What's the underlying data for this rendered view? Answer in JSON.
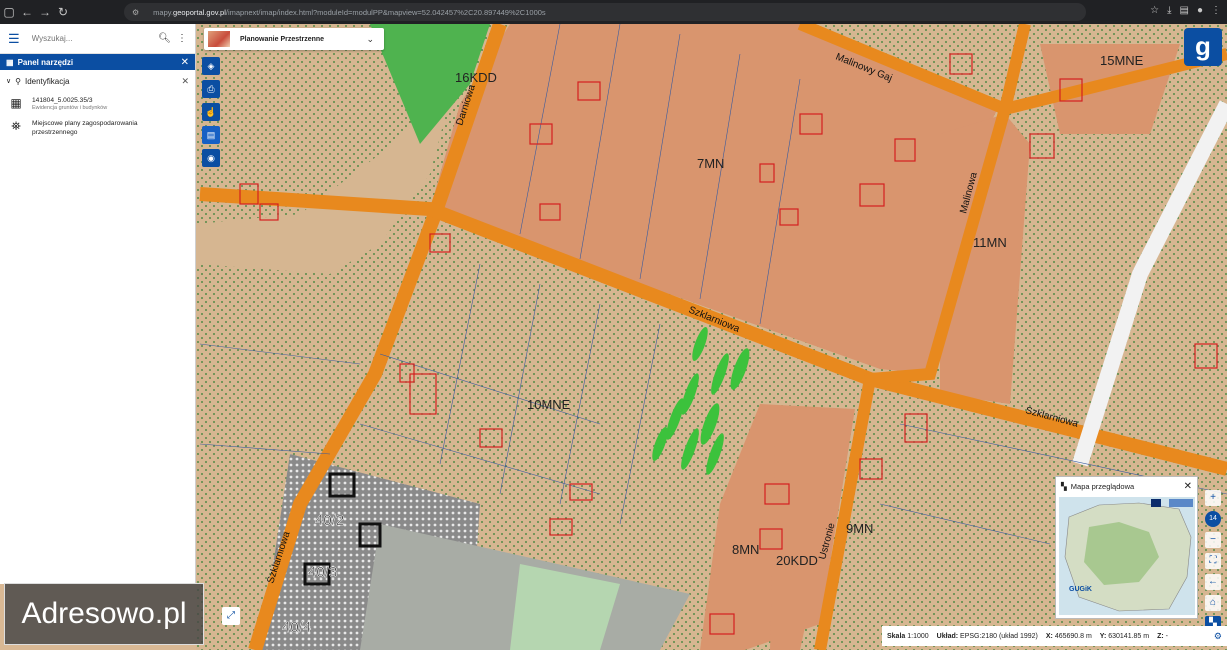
{
  "browser": {
    "url_prefix": "mapy.",
    "url_domain": "geoportal.gov.pl",
    "url_rest": "/imapnext/imap/index.html?moduleId=modulPP&mapview=52.042457%2C20.897449%2C1000s",
    "icons": [
      "back-arrow",
      "forward-arrow",
      "reload",
      "bookmark-star",
      "download",
      "extensions",
      "profile"
    ]
  },
  "search": {
    "placeholder": "Wyszukaj..."
  },
  "panel": {
    "title": "Panel narzędzi",
    "section": "Identyfikacja",
    "results": [
      {
        "title": "141804_5.0025.35/3",
        "subtitle": "Ewidencja gruntów i budynków",
        "icon": "building-grid-icon"
      },
      {
        "title": "Miejscowe plany zagospodarowania przestrzennego",
        "subtitle": "",
        "icon": "map-pin-icon"
      }
    ]
  },
  "wms_layer": {
    "label": "Planowanie Przestrzenne"
  },
  "map_labels": {
    "streets": [
      "Malinowy Gaj",
      "Darniowa",
      "Szklarniowa",
      "Szklarniowa",
      "Malinowa",
      "Ustronie",
      "Szklarniowa"
    ],
    "zones": [
      "15MNE",
      "16KDD",
      "7MN",
      "11MN",
      "10MNE",
      "9MN",
      "8MN",
      "20KDD",
      "40/2",
      "40/3",
      "40/4"
    ]
  },
  "overview": {
    "title": "Mapa przeglądowa",
    "logo": "GUGiK"
  },
  "zoom": {
    "level": "14"
  },
  "status": {
    "scale_label": "Skala",
    "scale_value": "1:1000",
    "crs_label": "Układ:",
    "crs_value": "EPSG:2180 (układ 1992)",
    "x_label": "X:",
    "x_value": "465690.8 m",
    "y_label": "Y:",
    "y_value": "630141.85 m",
    "z_label": "Z:",
    "z_value": "-"
  },
  "watermark": {
    "text": "Adresowo.pl"
  },
  "colors": {
    "brand_blue": "#0b4ea2",
    "road_orange": "#e8891e",
    "zone_salmon": "#d9956e",
    "zone_tan": "#d9b894",
    "green_area": "#4fb34f",
    "parcel_red": "#d42020"
  }
}
